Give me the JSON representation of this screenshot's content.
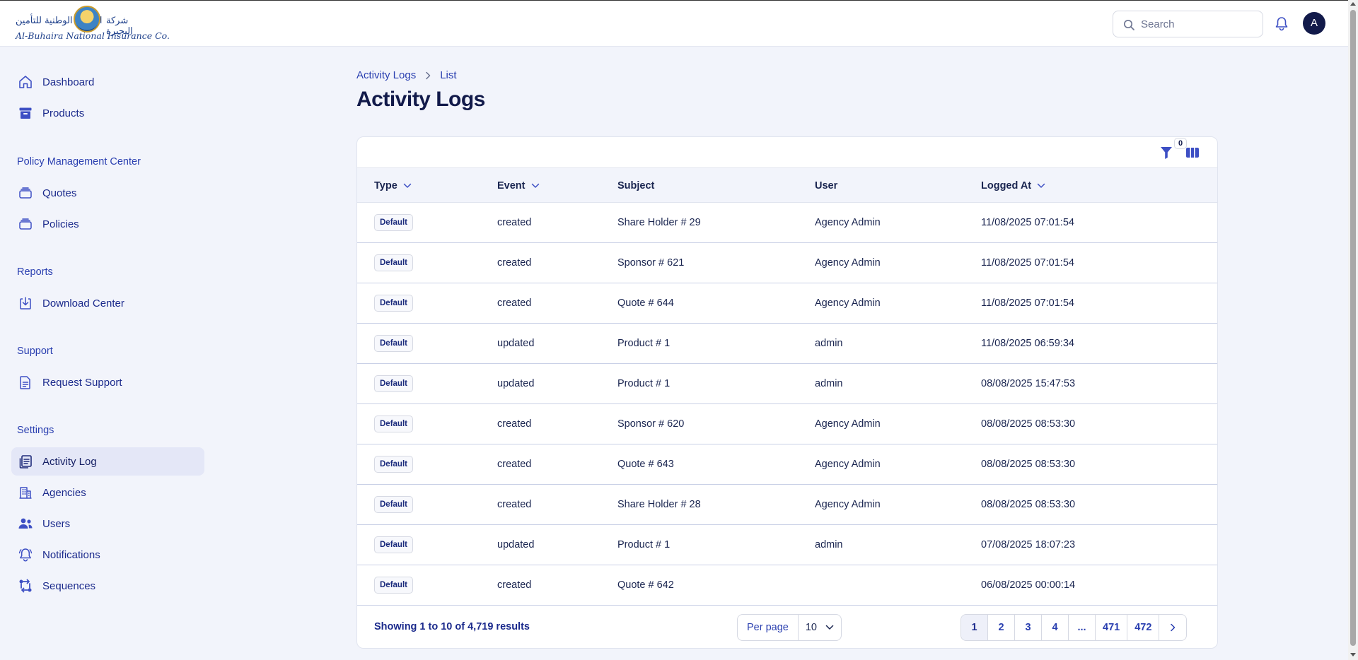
{
  "brand": {
    "name_en": "Al-Buhaira National Insurance Co.",
    "name_ar_left": "البحيرة الوطنية للتأمين",
    "name_ar_right": "شركة البحيرة"
  },
  "search": {
    "placeholder": "Search"
  },
  "user": {
    "initial": "A"
  },
  "sidebar": {
    "top_items": [
      {
        "label": "Dashboard",
        "icon": "home-icon"
      },
      {
        "label": "Products",
        "icon": "archive-box-icon"
      }
    ],
    "groups": [
      {
        "title": "Policy Management Center",
        "items": [
          {
            "label": "Quotes",
            "icon": "stack-icon"
          },
          {
            "label": "Policies",
            "icon": "stack-icon"
          }
        ]
      },
      {
        "title": "Reports",
        "items": [
          {
            "label": "Download Center",
            "icon": "download-icon"
          }
        ]
      },
      {
        "title": "Support",
        "items": [
          {
            "label": "Request Support",
            "icon": "document-icon"
          }
        ]
      },
      {
        "title": "Settings",
        "items": [
          {
            "label": "Activity Log",
            "icon": "clipboard-icon",
            "active": true
          },
          {
            "label": "Agencies",
            "icon": "building-icon"
          },
          {
            "label": "Users",
            "icon": "users-icon"
          },
          {
            "label": "Notifications",
            "icon": "bell-icon"
          },
          {
            "label": "Sequences",
            "icon": "arrows-icon"
          }
        ]
      }
    ]
  },
  "breadcrumb": {
    "parent": "Activity Logs",
    "current": "List"
  },
  "page": {
    "title": "Activity Logs"
  },
  "toolbar": {
    "filter_count": "0"
  },
  "table": {
    "columns": [
      {
        "label": "Type",
        "sortable": true
      },
      {
        "label": "Event",
        "sortable": true
      },
      {
        "label": "Subject",
        "sortable": false
      },
      {
        "label": "User",
        "sortable": false
      },
      {
        "label": "Logged At",
        "sortable": true
      }
    ],
    "rows": [
      {
        "type": "Default",
        "event": "created",
        "subject": "Share Holder # 29",
        "user": "Agency Admin",
        "logged_at": "11/08/2025 07:01:54"
      },
      {
        "type": "Default",
        "event": "created",
        "subject": "Sponsor # 621",
        "user": "Agency Admin",
        "logged_at": "11/08/2025 07:01:54"
      },
      {
        "type": "Default",
        "event": "created",
        "subject": "Quote # 644",
        "user": "Agency Admin",
        "logged_at": "11/08/2025 07:01:54"
      },
      {
        "type": "Default",
        "event": "updated",
        "subject": "Product # 1",
        "user": "admin",
        "logged_at": "11/08/2025 06:59:34"
      },
      {
        "type": "Default",
        "event": "updated",
        "subject": "Product # 1",
        "user": "admin",
        "logged_at": "08/08/2025 15:47:53"
      },
      {
        "type": "Default",
        "event": "created",
        "subject": "Sponsor # 620",
        "user": "Agency Admin",
        "logged_at": "08/08/2025 08:53:30"
      },
      {
        "type": "Default",
        "event": "created",
        "subject": "Quote # 643",
        "user": "Agency Admin",
        "logged_at": "08/08/2025 08:53:30"
      },
      {
        "type": "Default",
        "event": "created",
        "subject": "Share Holder # 28",
        "user": "Agency Admin",
        "logged_at": "08/08/2025 08:53:30"
      },
      {
        "type": "Default",
        "event": "updated",
        "subject": "Product # 1",
        "user": "admin",
        "logged_at": "07/08/2025 18:07:23"
      },
      {
        "type": "Default",
        "event": "created",
        "subject": "Quote # 642",
        "user": "",
        "logged_at": "06/08/2025 00:00:14"
      }
    ]
  },
  "footer": {
    "results": "Showing 1 to 10 of 4,719 results",
    "per_page_label": "Per page",
    "per_page_value": "10",
    "pages": [
      "1",
      "2",
      "3",
      "4",
      "...",
      "471",
      "472"
    ],
    "current_page": "1"
  },
  "colors": {
    "accent": "#2a3fb0",
    "dark": "#121a4a",
    "background": "#f2f4fb",
    "active_bg": "#e4e7f7"
  }
}
